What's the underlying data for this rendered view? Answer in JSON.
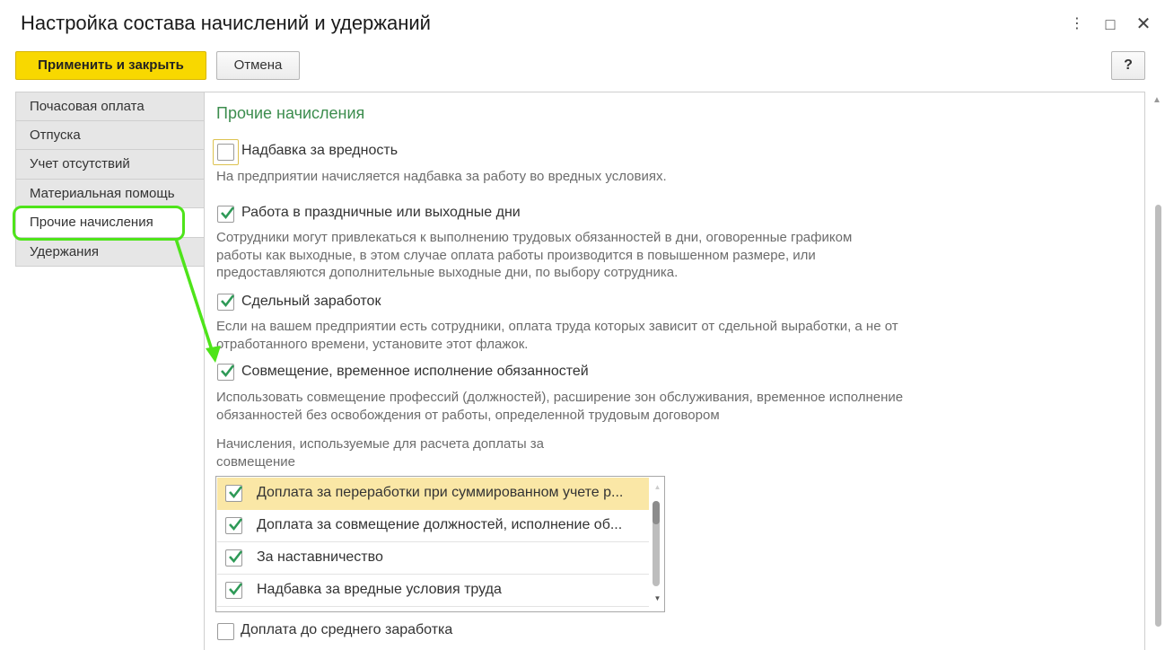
{
  "window": {
    "title": "Настройка состава начислений и удержаний",
    "more_icon": "more-vertical-icon",
    "maximize_icon": "maximize-icon",
    "close_icon": "close-icon"
  },
  "toolbar": {
    "apply_close_label": "Применить и закрыть",
    "cancel_label": "Отмена",
    "help_label": "?"
  },
  "tabs": [
    {
      "label": "Почасовая оплата"
    },
    {
      "label": "Отпуска"
    },
    {
      "label": "Учет отсутствий"
    },
    {
      "label": "Материальная помощь"
    },
    {
      "label": "Прочие начисления",
      "active": true
    },
    {
      "label": "Удержания"
    }
  ],
  "section": {
    "title": "Прочие начисления",
    "options": [
      {
        "label": "Надбавка за вредность",
        "checked": false,
        "desc": "На предприятии начисляется надбавка за работу во вредных условиях."
      },
      {
        "label": "Работа в праздничные или выходные дни",
        "checked": true,
        "desc_lines": [
          "Сотрудники могут привлекаться к выполнению трудовых обязанностей в дни, оговоренные графиком",
          "работы как выходные, в этом случае оплата работы производится в повышенном размере, или",
          "предоставляются дополнительные выходные дни, по выбору сотрудника."
        ]
      },
      {
        "label": "Сдельный заработок",
        "checked": true,
        "desc_lines": [
          "Если на вашем предприятии есть сотрудники, оплата труда которых зависит от сдельной выработки, а не от",
          "отработанного времени, установите этот флажок."
        ]
      },
      {
        "label": "Совмещение, временное исполнение обязанностей",
        "checked": true,
        "desc_lines": [
          "Использовать совмещение профессий (должностей), расширение зон обслуживания, временное исполнение",
          "обязанностей без освобождения от работы, определенной трудовым договором"
        ]
      },
      {
        "label": "Доплата до среднего заработка",
        "checked": false
      }
    ],
    "list_caption_lines": [
      "Начисления, используемые для расчета доплаты за",
      "совмещение"
    ],
    "list_items": [
      {
        "label": "Доплата за переработки при суммированном учете р...",
        "checked": true,
        "selected": true
      },
      {
        "label": "Доплата за совмещение должностей, исполнение об...",
        "checked": true
      },
      {
        "label": "За наставничество",
        "checked": true
      },
      {
        "label": "Надбавка за вредные условия труда",
        "checked": true
      }
    ]
  },
  "colors": {
    "primary_button": "#f8d800",
    "section_title": "#3c8d4e",
    "checkmark": "#2e9a57",
    "selected_row": "#fae7a6",
    "annotation": "#4ee41a"
  }
}
